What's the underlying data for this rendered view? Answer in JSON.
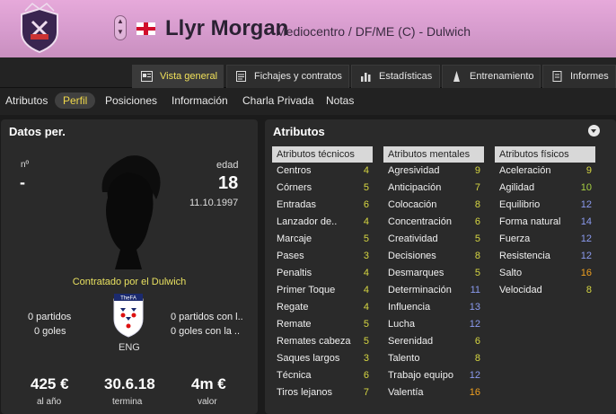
{
  "header": {
    "player_name": "Llyr Morgan",
    "role": "Mediocentro / DF/ME (C) - Dulwich",
    "colors": {
      "background": "#d69bcd",
      "name": "#2b2233"
    }
  },
  "tabs": [
    {
      "label": "Vista general",
      "icon": "overview-icon",
      "active": true
    },
    {
      "label": "Fichajes y contratos",
      "icon": "contract-icon",
      "active": false
    },
    {
      "label": "Estadísticas",
      "icon": "stats-icon",
      "active": false
    },
    {
      "label": "Entrenamiento",
      "icon": "training-icon",
      "active": false
    },
    {
      "label": "Informes",
      "icon": "reports-icon",
      "active": false
    }
  ],
  "subnav": [
    "Atributos",
    "Perfil",
    "Posiciones",
    "Información",
    "Charla Privada",
    "Notas"
  ],
  "subnav_active": "Perfil",
  "personal": {
    "title": "Datos per.",
    "number_label": "nº",
    "number_value": "-",
    "age_label": "edad",
    "age_value": "18",
    "birthdate": "11.10.1997",
    "contract_text": "Contratado por el Dulwich",
    "badge_text": "TheFA",
    "nation": "ENG",
    "apps": "0 partidos",
    "goals": "0 goles",
    "intl_apps": "0 partidos con l..",
    "intl_goals": "0 goles con la ..",
    "wage": "425 €",
    "wage_label": "al año",
    "expires": "30.6.18",
    "expires_label": "termina",
    "value": "4m €",
    "value_label": "valor"
  },
  "attributes": {
    "title": "Atributos",
    "colors": {
      "low": "#d7d742",
      "mid": "#a7d142",
      "high": "#8b9bf0",
      "top": "#f0a020"
    },
    "technical": {
      "header": "Atributos técnicos",
      "items": [
        {
          "name": "Centros",
          "value": "4",
          "tier": "low"
        },
        {
          "name": "Córners",
          "value": "5",
          "tier": "low"
        },
        {
          "name": "Entradas",
          "value": "6",
          "tier": "low"
        },
        {
          "name": "Lanzador de..",
          "value": "4",
          "tier": "low"
        },
        {
          "name": "Marcaje",
          "value": "5",
          "tier": "low"
        },
        {
          "name": "Pases",
          "value": "3",
          "tier": "low"
        },
        {
          "name": "Penaltis",
          "value": "4",
          "tier": "low"
        },
        {
          "name": "Primer Toque",
          "value": "4",
          "tier": "low"
        },
        {
          "name": "Regate",
          "value": "4",
          "tier": "low"
        },
        {
          "name": "Remate",
          "value": "5",
          "tier": "low"
        },
        {
          "name": "Remates cabeza",
          "value": "5",
          "tier": "low"
        },
        {
          "name": "Saques largos",
          "value": "3",
          "tier": "low"
        },
        {
          "name": "Técnica",
          "value": "6",
          "tier": "low"
        },
        {
          "name": "Tiros lejanos",
          "value": "7",
          "tier": "low"
        }
      ]
    },
    "mental": {
      "header": "Atributos mentales",
      "items": [
        {
          "name": "Agresividad",
          "value": "9",
          "tier": "low"
        },
        {
          "name": "Anticipación",
          "value": "7",
          "tier": "low"
        },
        {
          "name": "Colocación",
          "value": "8",
          "tier": "low"
        },
        {
          "name": "Concentración",
          "value": "6",
          "tier": "low"
        },
        {
          "name": "Creatividad",
          "value": "5",
          "tier": "low"
        },
        {
          "name": "Decisiones",
          "value": "8",
          "tier": "low"
        },
        {
          "name": "Desmarques",
          "value": "5",
          "tier": "low"
        },
        {
          "name": "Determinación",
          "value": "11",
          "tier": "high"
        },
        {
          "name": "Influencia",
          "value": "13",
          "tier": "high"
        },
        {
          "name": "Lucha",
          "value": "12",
          "tier": "high"
        },
        {
          "name": "Serenidad",
          "value": "6",
          "tier": "low"
        },
        {
          "name": "Talento",
          "value": "8",
          "tier": "low"
        },
        {
          "name": "Trabajo equipo",
          "value": "12",
          "tier": "high"
        },
        {
          "name": "Valentía",
          "value": "16",
          "tier": "top"
        }
      ]
    },
    "physical": {
      "header": "Atributos físicos",
      "items": [
        {
          "name": "Aceleración",
          "value": "9",
          "tier": "low"
        },
        {
          "name": "Agilidad",
          "value": "10",
          "tier": "mid"
        },
        {
          "name": "Equilibrio",
          "value": "12",
          "tier": "high"
        },
        {
          "name": "Forma natural",
          "value": "14",
          "tier": "high"
        },
        {
          "name": "Fuerza",
          "value": "12",
          "tier": "high"
        },
        {
          "name": "Resistencia",
          "value": "12",
          "tier": "high"
        },
        {
          "name": "Salto",
          "value": "16",
          "tier": "top"
        },
        {
          "name": "Velocidad",
          "value": "8",
          "tier": "low"
        }
      ]
    }
  }
}
